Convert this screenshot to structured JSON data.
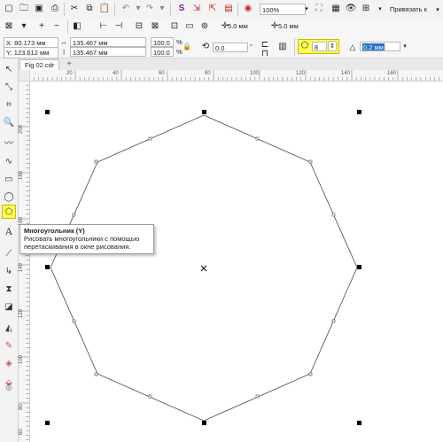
{
  "standard_toolbar": {
    "zoom": "100%",
    "snap": "Привязать к"
  },
  "property_bar": {
    "x": "X: 80.173 мм",
    "y": "Y: 123.612 мм",
    "width": "135.467 мм",
    "height": "135.467 мм",
    "scale_w": "100.0",
    "scale_h": "100.0",
    "percent": "%",
    "angle": "0.0",
    "nudge1": "5.0 мм",
    "nudge2": "5.0 мм",
    "sides": "8",
    "outline": "0.2 мм"
  },
  "document_tab": "Fig 02.cdr",
  "ruler": {
    "h_ticks": [
      "20",
      "40",
      "60",
      "80",
      "100",
      "120",
      "140",
      "160"
    ],
    "v_ticks": [
      "200",
      "180",
      "160",
      "140",
      "120",
      "100",
      "80",
      "60"
    ]
  },
  "tooltip": {
    "title": "Многоугольник (Y)",
    "description": "Рисовать многоугольники с помощью перетаскивания в окне рисования."
  },
  "colors": {
    "highlight": "#ffff54"
  }
}
